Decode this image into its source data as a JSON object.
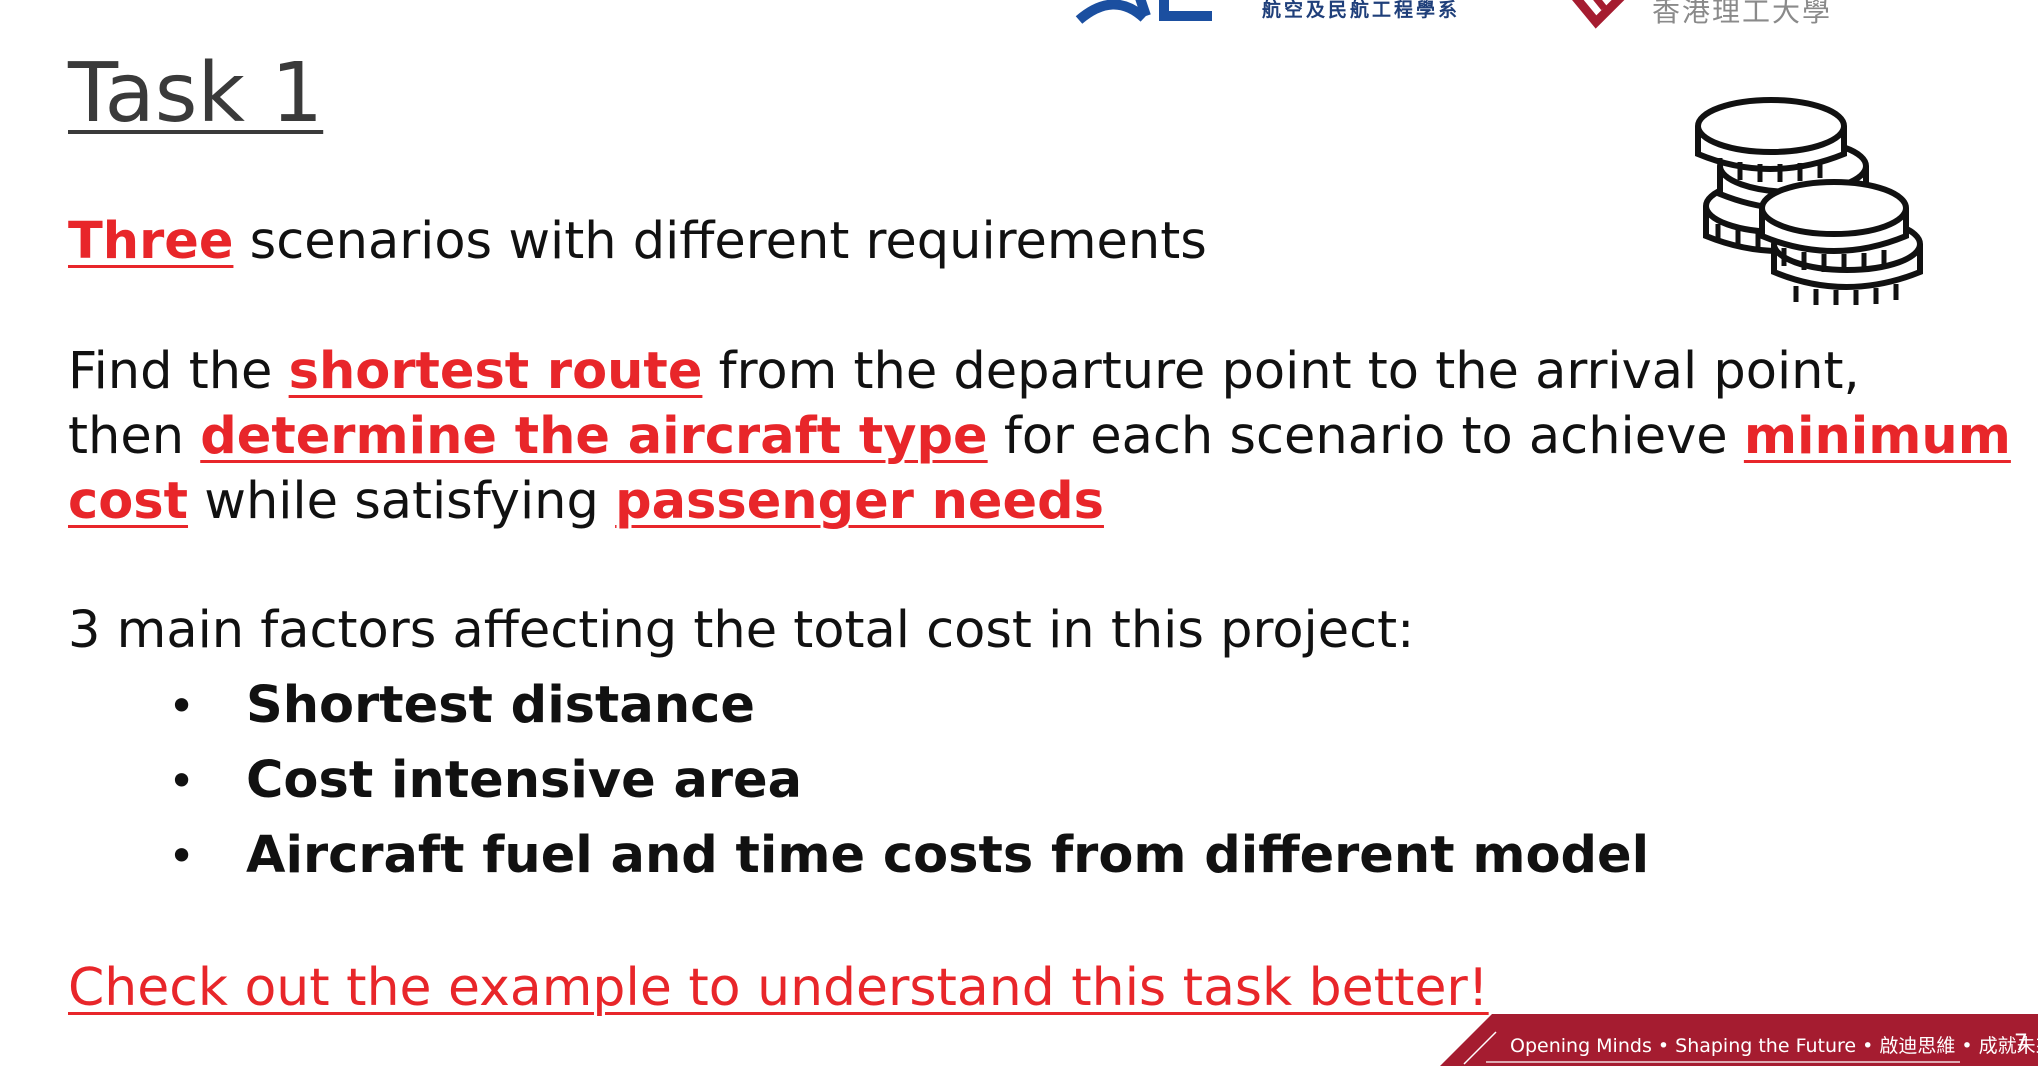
{
  "header": {
    "dept_name_cn": "航空及民航工程學系",
    "university_name_cn": "香港理工大學"
  },
  "slide": {
    "title": "Task 1",
    "intro": {
      "highlight": "Three",
      "rest": " scenarios with different requirements"
    },
    "paragraph": {
      "t1": "Find the ",
      "h1": "shortest route",
      "t2": " from the departure point to the arrival point,",
      "t3": "then ",
      "h2": "determine the aircraft type",
      "t4": " for each scenario to achieve ",
      "h3": "minimum",
      "h4": "cost",
      "t5": " while satisfying ",
      "h5": "passenger needs"
    },
    "factors_heading": "3 main factors affecting the total cost in this project:",
    "bullet_symbol": "•",
    "factors": [
      "Shortest distance",
      "Cost intensive area",
      "Aircraft fuel and time costs from different model"
    ],
    "call_to_action": "Check out the example to understand this task better!"
  },
  "footer": {
    "tagline": "Opening Minds • Shaping the Future • 啟迪思維 • 成就未來",
    "page_number": "7",
    "bar_color": "#a51c30"
  },
  "icons": {
    "coins": "coins-stack-icon"
  },
  "colors": {
    "highlight": "#e8262a",
    "text": "#111111",
    "title": "#3a3a3a"
  }
}
